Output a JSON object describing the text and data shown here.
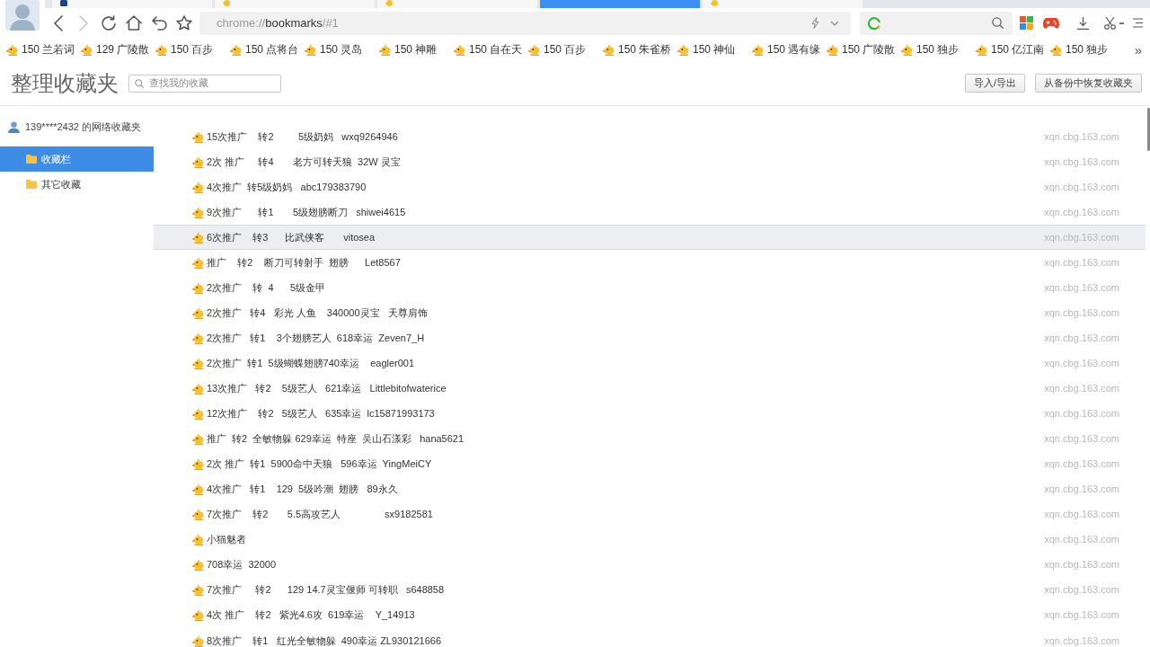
{
  "tabs": [
    {
      "kind": "portal",
      "selected": false
    },
    {
      "kind": "game",
      "selected": false
    },
    {
      "kind": "game",
      "selected": false
    },
    {
      "kind": "page",
      "selected": true
    },
    {
      "kind": "game",
      "selected": false
    }
  ],
  "toolbar": {
    "back_disabled": false,
    "forward_disabled": true
  },
  "address_bar": {
    "url": "chrome://**bookmarks**/#1"
  },
  "bookmarks_bar": {
    "items": [
      "150 兰若词",
      "129 广陵散",
      "150 百步",
      "150 点将台",
      "150 灵岛",
      "150 神雕",
      "150 自在天",
      "150 百步",
      "150 朱雀桥",
      "150 神仙",
      "150 遇有缘",
      "150 广陵散",
      "150 独步",
      "150 亿江南",
      "150 独步"
    ],
    "overflow": "»"
  },
  "header": {
    "title": "整理收藏夹",
    "search": {
      "placeholder": "查找我的收藏"
    },
    "buttons": [
      "导入/导出",
      "从备份中恢复收藏夹"
    ]
  },
  "sidebar": {
    "account": "139****2432 的网络收藏夹",
    "items": [
      {
        "label": "收藏栏",
        "selected": true
      },
      {
        "label": "其它收藏",
        "selected": false
      }
    ]
  },
  "bookmarks": [
    {
      "title": "15次推广    转2         5级奶妈   wxq9264946",
      "url": "xqn.cbg.163.com",
      "highlighted": false
    },
    {
      "title": "2次 推广     转4       老方可转天狼  32W 灵宝",
      "url": "xqn.cbg.163.com",
      "highlighted": false
    },
    {
      "title": "4次推广  转5级奶妈   abc179383790",
      "url": "xqn.cbg.163.com",
      "highlighted": false
    },
    {
      "title": "9次推广      转1       5级翅膀断刀   shiwei4615",
      "url": "xqn.cbg.163.com",
      "highlighted": false
    },
    {
      "title": "6次推广    转3      比武侠客       vitosea",
      "url": "xqn.cbg.163.com",
      "highlighted": true
    },
    {
      "title": "推广    转2    断刀可转射手  翅膀      Let8567",
      "url": "xqn.cbg.163.com",
      "highlighted": false
    },
    {
      "title": "2次推广    转  4      5级金甲",
      "url": "xqn.cbg.163.com",
      "highlighted": false
    },
    {
      "title": "2次推广   转4   彩光 人鱼    340000灵宝   天尊肩饰",
      "url": "xqn.cbg.163.com",
      "highlighted": false
    },
    {
      "title": "2次推广   转1    3个翅膀艺人  618幸运  Zeven7_H",
      "url": "xqn.cbg.163.com",
      "highlighted": false
    },
    {
      "title": "2次推广  转1  5级蝴蝶翅膀740幸运    eagler001",
      "url": "xqn.cbg.163.com",
      "highlighted": false
    },
    {
      "title": "13次推广   转2    5级艺人   621幸运   Littlebitofwaterice",
      "url": "xqn.cbg.163.com",
      "highlighted": false
    },
    {
      "title": "12次推广    转2   5级艺人   635幸运  lc15871993173",
      "url": "xqn.cbg.163.com",
      "highlighted": false
    },
    {
      "title": "推广  转2  全敏物躲 629幸运  特座  吴山石漾彩   hana5621",
      "url": "xqn.cbg.163.com",
      "highlighted": false
    },
    {
      "title": "2次 推广  转1  5900命中天狼   596幸运  YingMeiCY",
      "url": "xqn.cbg.163.com",
      "highlighted": false
    },
    {
      "title": "4次推广   转1    129  5级吟潮  翅膀   89永久",
      "url": "xqn.cbg.163.com",
      "highlighted": false
    },
    {
      "title": "7次推广    转2       5.5高攻艺人                sx9182581",
      "url": "xqn.cbg.163.com",
      "highlighted": false
    },
    {
      "title": "小猫魅者",
      "url": "xqn.cbg.163.com",
      "highlighted": false
    },
    {
      "title": "708幸运  32000",
      "url": "xqn.cbg.163.com",
      "highlighted": false
    },
    {
      "title": "7次推广     转2      129 14.7灵宝偃师 可转职   s648858",
      "url": "xqn.cbg.163.com",
      "highlighted": false
    },
    {
      "title": "4次 推广    转2   紫光4.6攻  619幸运    Y_14913",
      "url": "xqn.cbg.163.com",
      "highlighted": false
    },
    {
      "title": "8次推广    转1   红光全敏物躲  490幸运 ZL930121666",
      "url": "xqn.cbg.163.com",
      "highlighted": false
    }
  ]
}
